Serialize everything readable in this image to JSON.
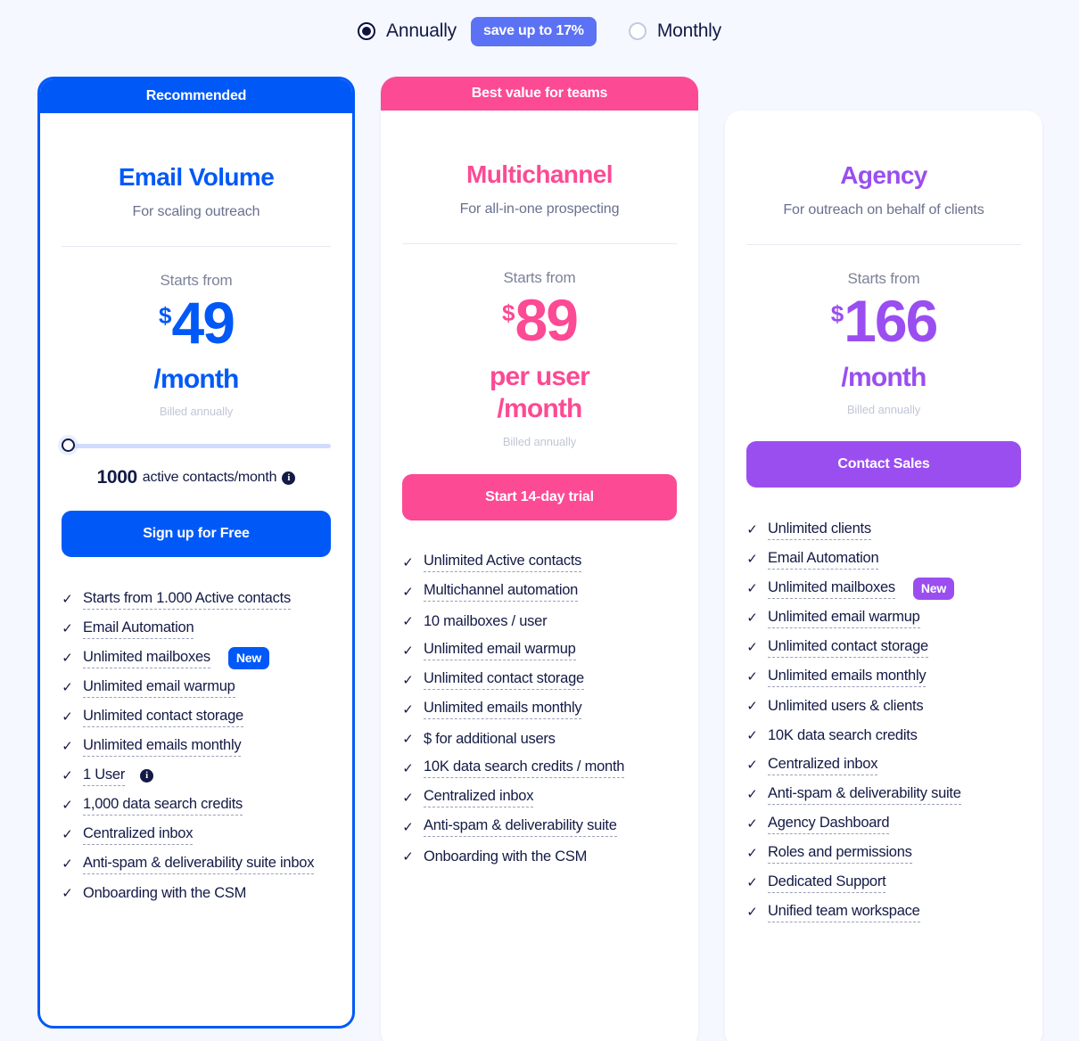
{
  "billing": {
    "annually": {
      "label": "Annually",
      "selected": true
    },
    "save_badge": "save up to 17%",
    "monthly": {
      "label": "Monthly",
      "selected": false
    }
  },
  "colors": {
    "blue": "#0059f7",
    "pink": "#fc4a94",
    "purple": "#9a4ef0",
    "badge_blue": "#5c72f5",
    "page_bg": "#f5f8ff",
    "text": "#131a45"
  },
  "plans": [
    {
      "ribbon": "Recommended",
      "name": "Email Volume",
      "tagline": "For scaling outreach",
      "starts_from": "Starts from",
      "currency": "$",
      "amount": "49",
      "period": "/month",
      "billed_note": "Billed annually",
      "slider": {
        "count": "1000",
        "unit": "active contacts/month",
        "info": "i"
      },
      "cta": "Sign up for Free",
      "features": [
        {
          "text": "Starts from 1.000 Active contacts",
          "dotted": true
        },
        {
          "text": "Email Automation",
          "dotted": true
        },
        {
          "text": "Unlimited mailboxes",
          "dotted": true,
          "badge": "New"
        },
        {
          "text": "Unlimited email warmup",
          "dotted": true
        },
        {
          "text": "Unlimited contact storage",
          "dotted": true
        },
        {
          "text": "Unlimited emails monthly",
          "dotted": true
        },
        {
          "text": "1 User",
          "dotted": true,
          "info": "i"
        },
        {
          "text": "1,000 data search credits",
          "dotted": true
        },
        {
          "text": "Centralized inbox",
          "dotted": true
        },
        {
          "text": "Anti-spam & deliverability suite inbox",
          "dotted": true
        },
        {
          "text": "Onboarding with the CSM",
          "dotted": false
        }
      ]
    },
    {
      "ribbon": "Best value for teams",
      "name": "Multichannel",
      "tagline": "For all-in-one prospecting",
      "starts_from": "Starts from",
      "currency": "$",
      "amount": "89",
      "period": "per user\n/month",
      "billed_note": "Billed annually",
      "cta": "Start 14-day trial",
      "features": [
        {
          "text": "Unlimited Active contacts",
          "dotted": true
        },
        {
          "text": "Multichannel automation",
          "dotted": true
        },
        {
          "text": "10 mailboxes / user",
          "dotted": false
        },
        {
          "text": "Unlimited email warmup",
          "dotted": true
        },
        {
          "text": "Unlimited contact storage",
          "dotted": true
        },
        {
          "text": "Unlimited emails monthly",
          "dotted": true
        },
        {
          "text": "$ for additional users",
          "dotted": false
        },
        {
          "text": "10K data search credits / month",
          "dotted": true
        },
        {
          "text": "Centralized inbox",
          "dotted": true
        },
        {
          "text": "Anti-spam & deliverability suite",
          "dotted": true
        },
        {
          "text": "Onboarding with the CSM",
          "dotted": false
        }
      ]
    },
    {
      "ribbon": "",
      "name": "Agency",
      "tagline": "For outreach on behalf of clients",
      "starts_from": "Starts from",
      "currency": "$",
      "amount": "166",
      "period": "/month",
      "billed_note": "Billed annually",
      "cta": "Contact Sales",
      "features": [
        {
          "text": "Unlimited clients",
          "dotted": true
        },
        {
          "text": "Email Automation",
          "dotted": true
        },
        {
          "text": "Unlimited mailboxes",
          "dotted": true,
          "badge": "New"
        },
        {
          "text": "Unlimited email warmup",
          "dotted": true
        },
        {
          "text": "Unlimited contact storage",
          "dotted": true
        },
        {
          "text": "Unlimited emails monthly",
          "dotted": true
        },
        {
          "text": "Unlimited users & clients",
          "dotted": false
        },
        {
          "text": "10K data search credits",
          "dotted": false
        },
        {
          "text": "Centralized inbox",
          "dotted": true
        },
        {
          "text": "Anti-spam & deliverability suite",
          "dotted": true
        },
        {
          "text": "Agency Dashboard",
          "dotted": true
        },
        {
          "text": "Roles and permissions",
          "dotted": true
        },
        {
          "text": "Dedicated Support",
          "dotted": true
        },
        {
          "text": "Unified team workspace",
          "dotted": true
        }
      ]
    }
  ]
}
